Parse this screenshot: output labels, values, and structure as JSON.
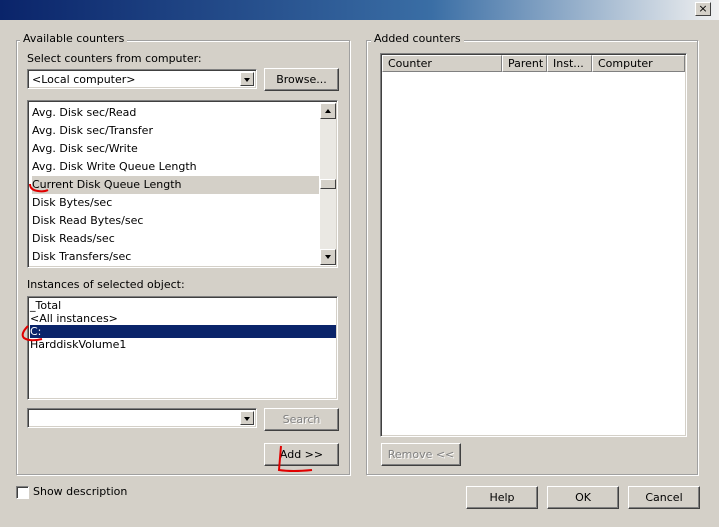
{
  "window": {
    "title": "",
    "close_glyph": "×"
  },
  "available": {
    "group_label": "Available counters",
    "select_label": "Select counters from computer:",
    "computer_value": "<Local computer>",
    "browse_label": "Browse...",
    "counters": [
      "Avg. Disk sec/Read",
      "Avg. Disk sec/Transfer",
      "Avg. Disk sec/Write",
      "Avg. Disk Write Queue Length",
      "Current Disk Queue Length",
      "Disk Bytes/sec",
      "Disk Read Bytes/sec",
      "Disk Reads/sec",
      "Disk Transfers/sec"
    ],
    "highlighted_counter": "Current Disk Queue Length",
    "instances_label": "Instances of selected object:",
    "instances": [
      "_Total",
      "<All instances>",
      "C:",
      "HarddiskVolume1"
    ],
    "selected_instance": "C:",
    "search_value": "",
    "search_label": "Search",
    "add_label": "Add >>"
  },
  "added": {
    "group_label": "Added counters",
    "columns": [
      "Counter",
      "Parent",
      "Inst...",
      "Computer"
    ],
    "rows": [],
    "remove_label": "Remove <<"
  },
  "footer": {
    "show_description_label": "Show description",
    "show_description_checked": false,
    "help_label": "Help",
    "ok_label": "OK",
    "cancel_label": "Cancel"
  },
  "colors": {
    "dialog_bg": "#d4d0c8",
    "selection_bg": "#0a246a",
    "annotation_red": "#e00000"
  }
}
